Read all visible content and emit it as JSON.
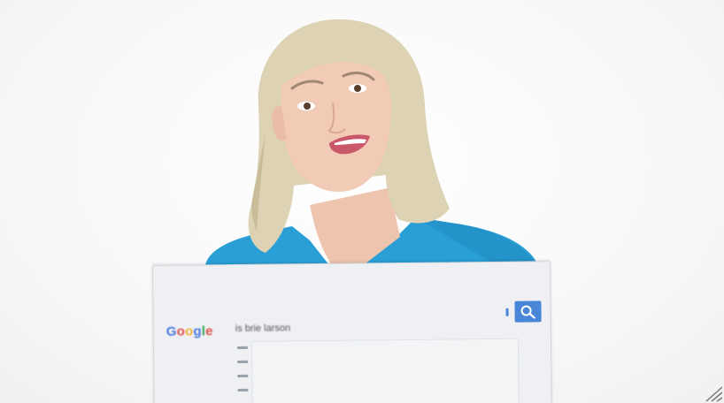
{
  "scene": {
    "subject": "person-holding-search-card",
    "colors": {
      "background": "#f7f7f7",
      "jacket": "#2a9fd6",
      "hair": "#ddd2b3",
      "card": "#eef0f3",
      "search_button": "#4a86d8"
    }
  },
  "card": {
    "logo_letters": [
      "G",
      "o",
      "o",
      "g",
      "l",
      "e"
    ],
    "query": "is brie larson",
    "search_icon": "magnifier-icon"
  }
}
